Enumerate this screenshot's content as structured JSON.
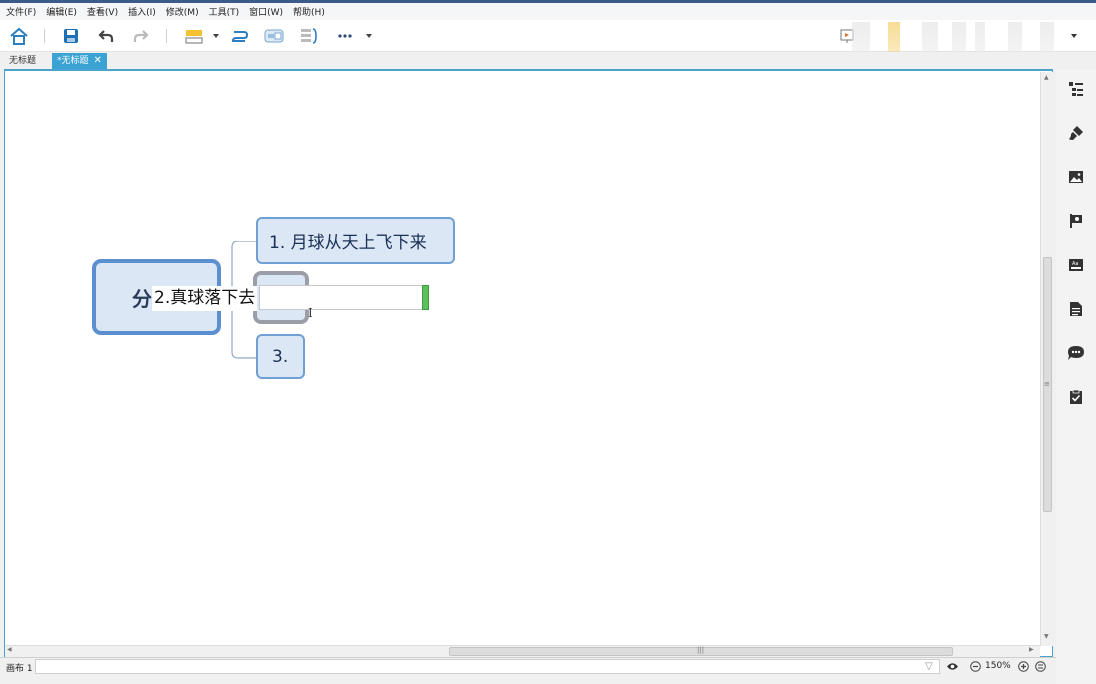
{
  "menu": {
    "items": [
      "文件(F)",
      "编辑(E)",
      "查看(V)",
      "插入(I)",
      "修改(M)",
      "工具(T)",
      "窗口(W)",
      "帮助(H)"
    ]
  },
  "toolbar": {
    "icons": [
      "home-icon",
      "save-icon",
      "undo-icon",
      "redo-icon",
      "topic-icon",
      "relationship-icon",
      "boundary-icon",
      "summary-icon",
      "more-icon",
      "presentation-icon"
    ]
  },
  "tabs": {
    "inactive_label": "无标题",
    "active_label": "*无标题",
    "close": "✕"
  },
  "mindmap": {
    "central_text": "分",
    "subtopic1": "1. 月球从天上飞下来",
    "subtopic3": "3.",
    "editing_text": "2.真球落下去"
  },
  "status": {
    "sheet_label": "画布 1",
    "zoom": "150%"
  },
  "right_panel": {
    "icons": [
      "outline-icon",
      "format-brush-icon",
      "image-icon",
      "marker-flag-icon",
      "label-icon",
      "notes-icon",
      "comment-icon",
      "task-icon"
    ]
  },
  "colors": {
    "accent": "#3aa3d4",
    "topic_fill": "#dce7f5",
    "topic_border": "#6f9fd3",
    "central_border": "#5b8fcf"
  }
}
